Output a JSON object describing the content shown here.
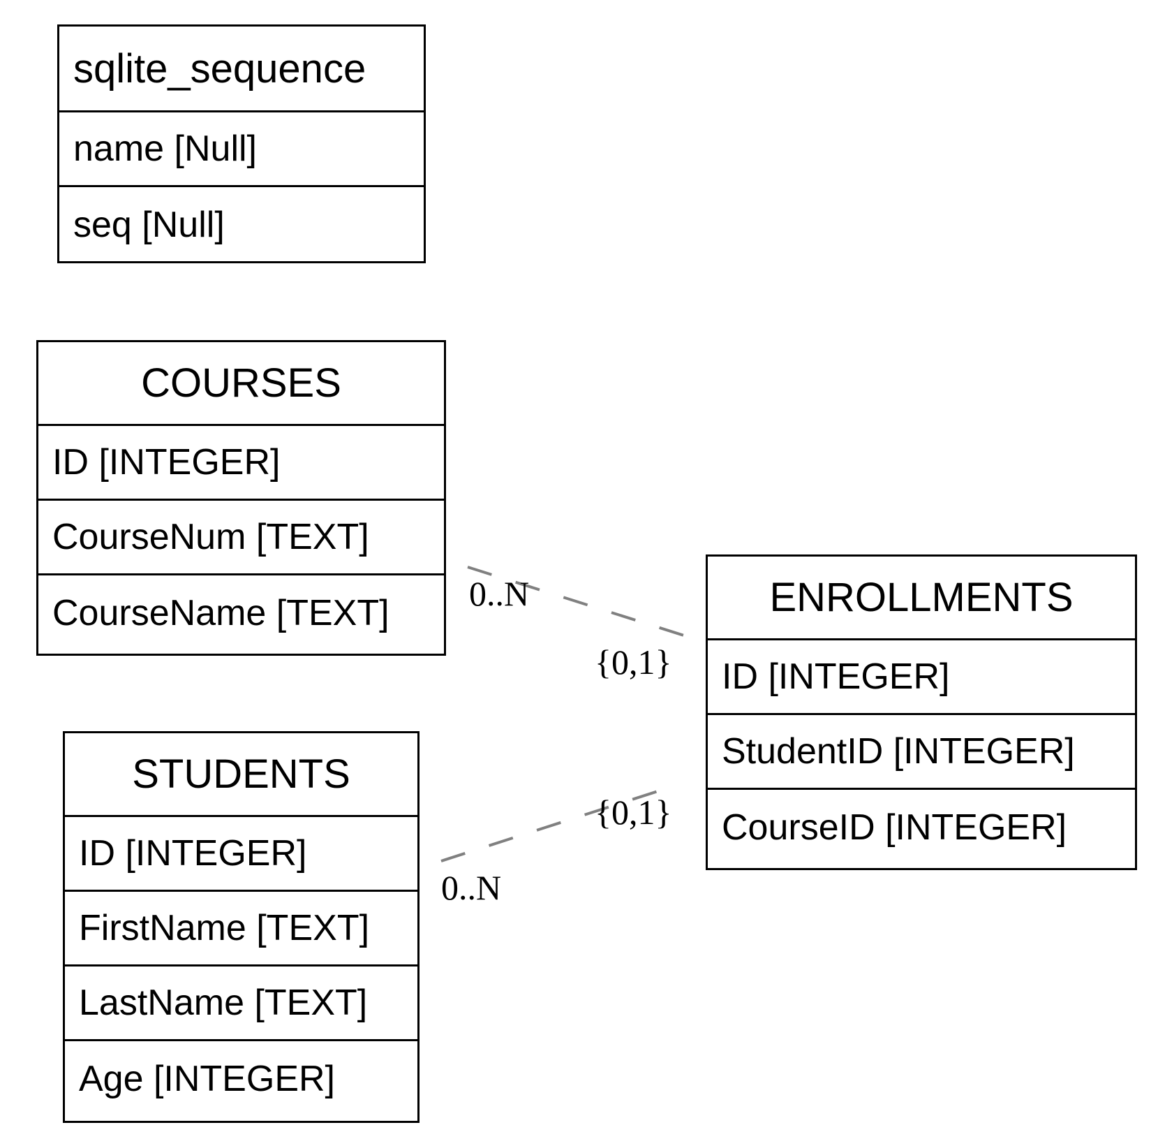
{
  "tables": {
    "sqlite_sequence": {
      "name": "sqlite_sequence",
      "columns": [
        "name [Null]",
        "seq [Null]"
      ]
    },
    "courses": {
      "name": "COURSES",
      "columns": [
        "ID [INTEGER]",
        "CourseNum [TEXT]",
        "CourseName [TEXT]"
      ]
    },
    "students": {
      "name": "STUDENTS",
      "columns": [
        "ID [INTEGER]",
        "FirstName [TEXT]",
        "LastName [TEXT]",
        "Age [INTEGER]"
      ]
    },
    "enrollments": {
      "name": "ENROLLMENTS",
      "columns": [
        "ID [INTEGER]",
        "StudentID [INTEGER]",
        "CourseID [INTEGER]"
      ]
    }
  },
  "relationships": [
    {
      "from": "COURSES",
      "to": "ENROLLMENTS",
      "from_cardinality": "0..N",
      "to_cardinality": "{0,1}"
    },
    {
      "from": "STUDENTS",
      "to": "ENROLLMENTS",
      "from_cardinality": "0..N",
      "to_cardinality": "{0,1}"
    }
  ],
  "colors": {
    "border": "#000000",
    "link": "#808080",
    "background": "#ffffff"
  }
}
